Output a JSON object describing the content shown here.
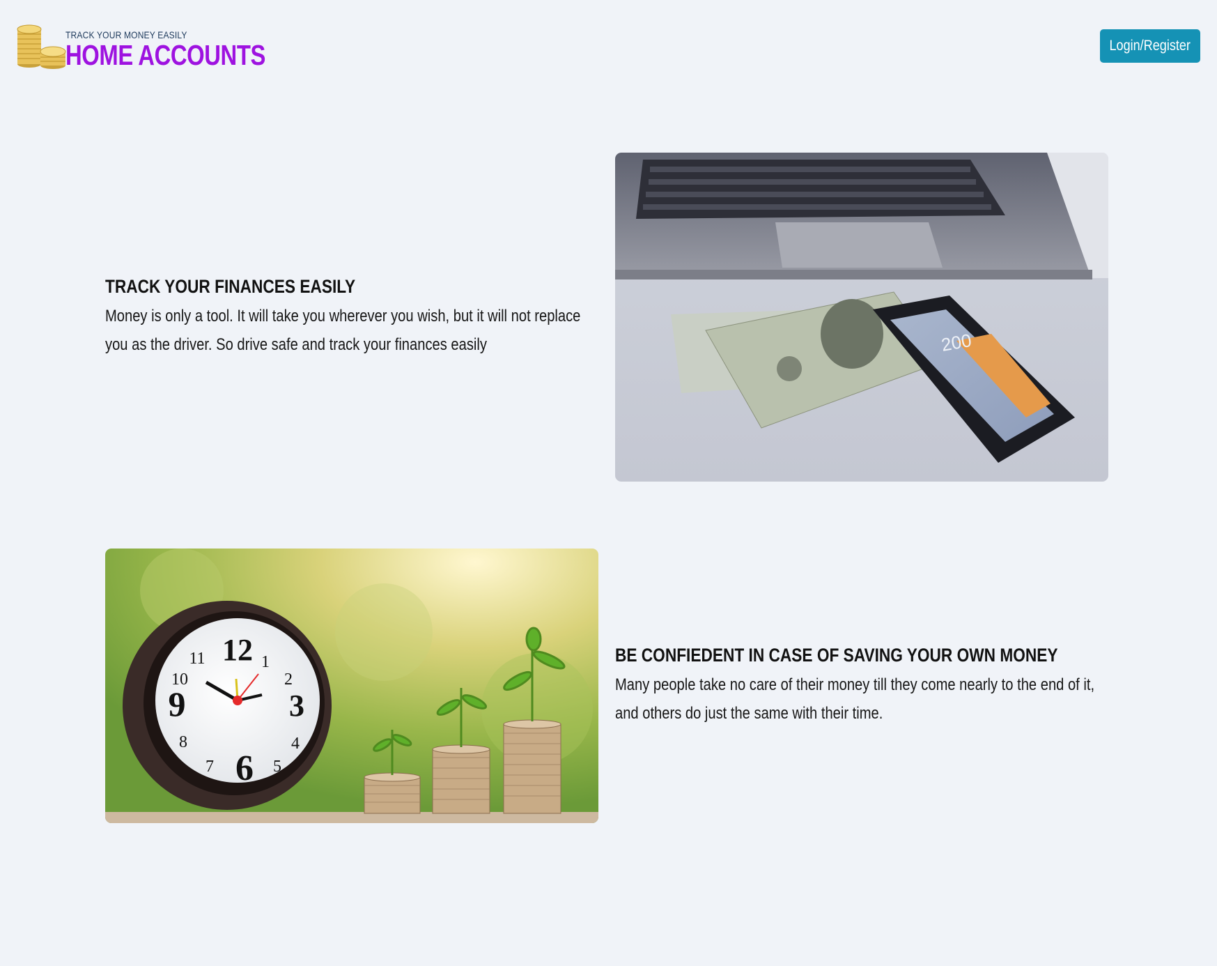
{
  "header": {
    "tagline": "TRACK YOUR MONEY EASILY",
    "title": "HOME ACCOUNTS",
    "login_label": "Login/Register",
    "title_color": "#9e12e0",
    "button_color": "#1592b5"
  },
  "sections": [
    {
      "heading": "TRACK YOUR FINANCES EASILY",
      "text": "Money is only a tool. It will take you wherever you wish, but it will not replace you as the driver. So drive safe and track your finances easily",
      "image": "laptop-cash-calculator-photo",
      "calculator_display": "200"
    },
    {
      "heading": "BE CONFIEDENT IN CASE OF SAVING YOUR OWN MONEY",
      "text": "Many people take no care of their money till they come nearly to the end of it, and others do just the same with their time.",
      "image": "clock-coins-plants-photo",
      "clock_numbers": [
        "12",
        "1",
        "2",
        "3",
        "4",
        "5",
        "6",
        "7",
        "8",
        "9",
        "10",
        "11"
      ]
    }
  ]
}
